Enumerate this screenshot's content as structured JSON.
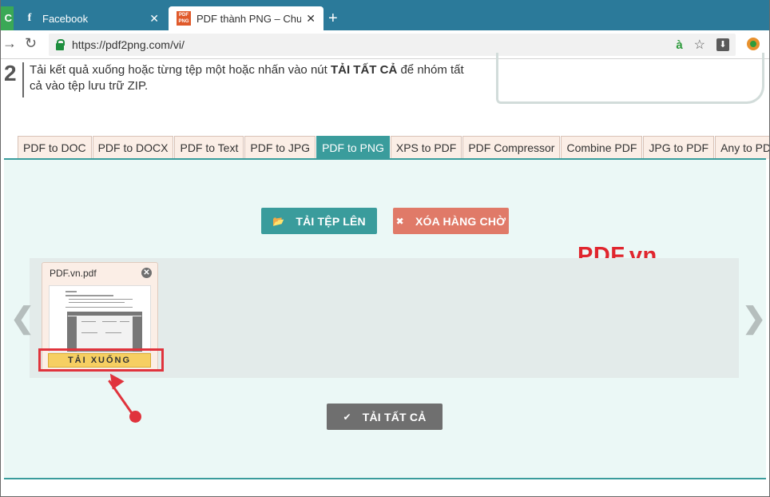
{
  "browser": {
    "edge_tab_label": "C",
    "tabs": [
      {
        "title": "Facebook",
        "icon": "facebook-icon",
        "close": "✕"
      },
      {
        "title": "PDF thành PNG – Chuyển",
        "icon": "pdf2png-favicon",
        "close": "✕"
      }
    ],
    "favicon_text": "PDF PNG",
    "new_tab": "+",
    "url": "https://pdf2png.com/vi/",
    "translate_glyph": "à"
  },
  "step": {
    "number": "2",
    "text_before": "Tải kết quả xuống hoặc từng tệp một hoặc nhấn vào nút ",
    "text_bold": "TẢI TẤT CẢ",
    "text_after": " để nhóm tất cả vào tệp lưu trữ ZIP."
  },
  "converter_tabs": [
    {
      "label": "PDF to DOC",
      "active": false
    },
    {
      "label": "PDF to DOCX",
      "active": false
    },
    {
      "label": "PDF to Text",
      "active": false
    },
    {
      "label": "PDF to JPG",
      "active": false
    },
    {
      "label": "PDF to PNG",
      "active": true
    },
    {
      "label": "XPS to PDF",
      "active": false
    },
    {
      "label": "PDF Compressor",
      "active": false
    },
    {
      "label": "Combine PDF",
      "active": false
    },
    {
      "label": "JPG to PDF",
      "active": false
    },
    {
      "label": "Any to PDF",
      "active": false
    }
  ],
  "actions": {
    "upload_label": "TẢI TỆP LÊN",
    "clear_label": "XÓA HÀNG CHỜ",
    "download_all_label": "TẢI TẤT CẢ"
  },
  "brand_watermark": "PDF.vn",
  "queue": {
    "prev_arrow": "❮",
    "next_arrow": "❯",
    "file": {
      "name": "PDF.vn.pdf",
      "download_label": "TẢI XUỐNG"
    }
  },
  "colors": {
    "teal": "#3a9c9c",
    "salmon": "#e07a68",
    "gray_button": "#6f6f6f",
    "highlight_red": "#e0333c",
    "download_yellow": "#f6cf62"
  }
}
